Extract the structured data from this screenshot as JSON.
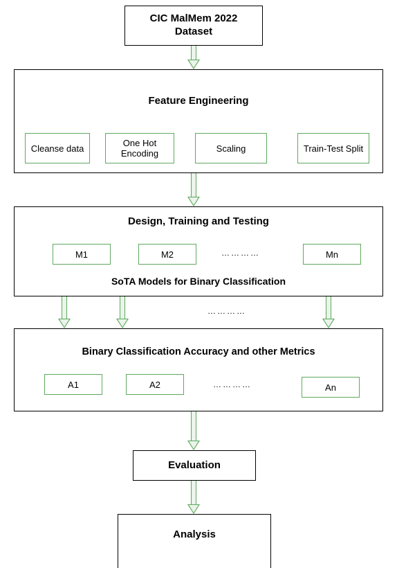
{
  "dataset": {
    "title_line1": "CIC MalMem 2022",
    "title_line2": "Dataset"
  },
  "feature_engineering": {
    "title": "Feature Engineering",
    "steps": [
      "Cleanse data",
      "One Hot Encoding",
      "Scaling",
      "Train-Test Split"
    ]
  },
  "design": {
    "title": "Design, Training and Testing",
    "models": [
      "M1",
      "M2",
      "Mn"
    ],
    "subtitle": "SoTA Models for Binary Classification",
    "ellipsis": "…………"
  },
  "metrics": {
    "title": "Binary Classification Accuracy and other Metrics",
    "items": [
      "A1",
      "A2",
      "An"
    ],
    "ellipsis": "…………"
  },
  "evaluation": {
    "label": "Evaluation"
  },
  "analysis": {
    "label": "Analysis"
  }
}
